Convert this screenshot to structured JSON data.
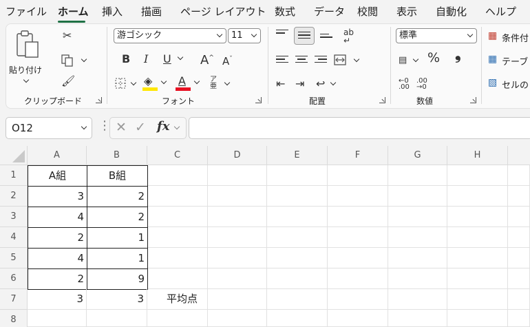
{
  "menu": {
    "tabs": [
      "ファイル",
      "ホーム",
      "挿入",
      "描画",
      "ページ レイアウト",
      "数式",
      "データ",
      "校閲",
      "表示",
      "自動化",
      "ヘルプ"
    ],
    "active": "ホーム"
  },
  "ribbon": {
    "clipboard": {
      "paste_label": "貼り付け",
      "group_label": "クリップボード"
    },
    "font": {
      "font_name": "游ゴシック",
      "font_size": "11",
      "group_label": "フォント"
    },
    "alignment": {
      "group_label": "配置"
    },
    "number": {
      "format": "標準",
      "percent": "%",
      "comma": "❟",
      "group_label": "数値"
    },
    "styles": {
      "conditional": "条件付",
      "table": "テーブ",
      "cell": "セルの"
    }
  },
  "formula_bar": {
    "name_box": "O12",
    "fx": "fx",
    "value": ""
  },
  "sheet": {
    "columns": [
      "A",
      "B",
      "C",
      "D",
      "E",
      "F",
      "G",
      "H"
    ],
    "rows": [
      "1",
      "2",
      "3",
      "4",
      "5",
      "6",
      "7",
      "8"
    ],
    "cells": {
      "A1": "A組",
      "B1": "B組",
      "A2": "3",
      "B2": "2",
      "A3": "4",
      "B3": "2",
      "A4": "2",
      "B4": "1",
      "A5": "4",
      "B5": "1",
      "A6": "2",
      "B6": "9",
      "A7": "3",
      "B7": "3",
      "C7": "平均点"
    }
  },
  "colors": {
    "accent": "#1f7145",
    "font_color": "#e81123",
    "highlight": "#ffe600"
  }
}
